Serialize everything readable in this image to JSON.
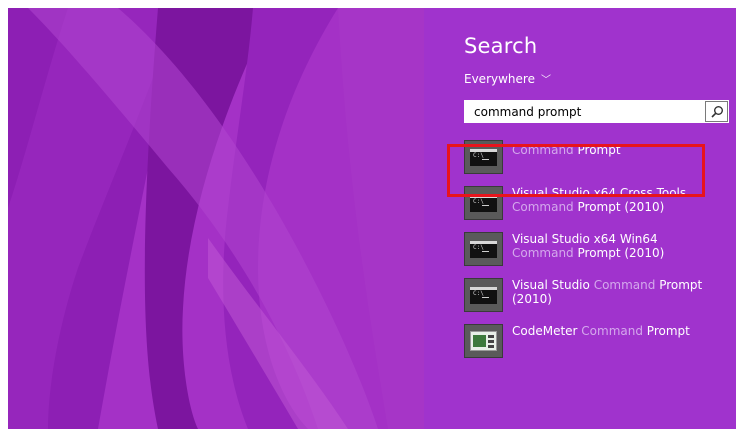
{
  "charm": {
    "title": "Search",
    "scope_label": "Everywhere",
    "query": "command prompt"
  },
  "results": [
    {
      "icon": "command-prompt-icon",
      "line1_dim": "Command",
      "line1_bold": " Prompt",
      "line2": ""
    },
    {
      "icon": "command-prompt-icon",
      "line1": "Visual Studio x64 Cross Tools",
      "line2_dim": "Command",
      "line2_bold": " Prompt (2010)"
    },
    {
      "icon": "command-prompt-icon",
      "line1": "Visual Studio x64 Win64",
      "line2_dim": "Command",
      "line2_bold": " Prompt (2010)"
    },
    {
      "icon": "command-prompt-icon",
      "line1_a": "Visual Studio ",
      "line1_dim": "Command",
      "line1_b": " Prompt",
      "line2": "(2010)"
    },
    {
      "icon": "codemeter-icon",
      "line1_a": "CodeMeter ",
      "line1_dim": "Command",
      "line1_b": " Prompt"
    }
  ],
  "colors": {
    "charm_bg": "#a033cd",
    "desktop_bg": "#a12fc4",
    "highlight": "#e8141c"
  }
}
